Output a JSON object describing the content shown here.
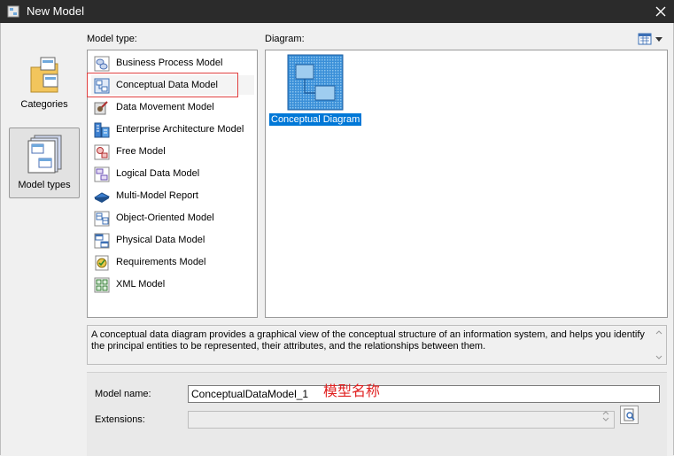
{
  "window": {
    "title": "New Model"
  },
  "left_pane": {
    "buttons": [
      {
        "label": "Categories",
        "selected": false,
        "icon": "categories-folder-icon"
      },
      {
        "label": "Model types",
        "selected": true,
        "icon": "model-types-icon"
      }
    ]
  },
  "model_type": {
    "label": "Model type:",
    "selected": "Conceptual Data Model",
    "items": [
      {
        "label": "Business Process Model",
        "icon": "business-process-model-icon"
      },
      {
        "label": "Conceptual Data Model",
        "icon": "conceptual-data-model-icon"
      },
      {
        "label": "Data Movement Model",
        "icon": "data-movement-model-icon"
      },
      {
        "label": "Enterprise Architecture Model",
        "icon": "enterprise-architecture-model-icon"
      },
      {
        "label": "Free Model",
        "icon": "free-model-icon"
      },
      {
        "label": "Logical Data Model",
        "icon": "logical-data-model-icon"
      },
      {
        "label": "Multi-Model Report",
        "icon": "multi-model-report-icon"
      },
      {
        "label": "Object-Oriented Model",
        "icon": "object-oriented-model-icon"
      },
      {
        "label": "Physical Data Model",
        "icon": "physical-data-model-icon"
      },
      {
        "label": "Requirements Model",
        "icon": "requirements-model-icon"
      },
      {
        "label": "XML Model",
        "icon": "xml-model-icon"
      }
    ]
  },
  "diagram": {
    "label": "Diagram:",
    "items": [
      {
        "label": "Conceptual Diagram",
        "selected": true
      }
    ]
  },
  "description": "A conceptual data diagram provides a graphical view of the conceptual structure of an information system, and helps you identify the principal entities to be represented, their attributes, and the relationships between them.",
  "form": {
    "model_name_label": "Model name:",
    "model_name_value": "ConceptualDataModel_1",
    "extensions_label": "Extensions:",
    "extensions_value": ""
  },
  "annotation": "模型名称",
  "colors": {
    "selection": "#0078d7",
    "titlebar": "#2b2b2b",
    "annotation": "#e02020"
  }
}
